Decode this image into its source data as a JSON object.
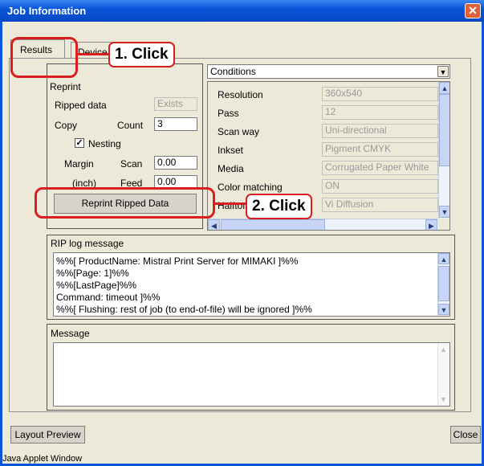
{
  "window": {
    "title": "Job Information",
    "close_symbol": "✕",
    "status": "Java Applet Window"
  },
  "tabs": [
    {
      "label": "Results"
    },
    {
      "label": "Device"
    }
  ],
  "callouts": {
    "first": "1. Click",
    "second": "2. Click"
  },
  "reprint": {
    "title": "Reprint",
    "ripped_data_label": "Ripped data",
    "ripped_data_value": "Exists",
    "copy_label": "Copy",
    "count_label": "Count",
    "count_value": "3",
    "nesting_label": "Nesting",
    "nesting_checked": true,
    "margin_label": "Margin",
    "inch_label": "(inch)",
    "scan_label": "Scan",
    "scan_value": "0.00",
    "feed_label": "Feed",
    "feed_value": "0.00",
    "button_label": "Reprint Ripped Data"
  },
  "conditions": {
    "selected": "Conditions",
    "rows": [
      {
        "label": "Resolution",
        "value": "360x540"
      },
      {
        "label": "Pass",
        "value": "12"
      },
      {
        "label": "Scan way",
        "value": "Uni-directional"
      },
      {
        "label": "Inkset",
        "value": "Pigment CMYK"
      },
      {
        "label": "Media",
        "value": "Corrugated Paper White"
      },
      {
        "label": "Color matching",
        "value": "ON"
      },
      {
        "label": "Halftone",
        "value": "Vi Diffusion"
      }
    ]
  },
  "rip_log": {
    "title": "RIP log message",
    "lines": [
      "%%[ ProductName: Mistral Print Server for MIMAKI ]%%",
      "%%[Page: 1]%%",
      "%%[LastPage]%%",
      "Command: timeout ]%%",
      "%%[ Flushing: rest of job (to end-of-file) will be ignored ]%%"
    ]
  },
  "message": {
    "title": "Message",
    "text": ""
  },
  "footer": {
    "layout_preview": "Layout Preview",
    "close": "Close"
  },
  "colors": {
    "title_bar": "#0a55d9",
    "callout_red": "#d81e1e",
    "window_bg": "#ece9d8"
  },
  "icons": {
    "close": "close-icon",
    "dropdown": "triangle-down-icon",
    "scroll_up": "chevron-up-icon",
    "scroll_down": "chevron-down-icon",
    "scroll_left": "chevron-left-icon",
    "scroll_right": "chevron-right-icon",
    "check": "checkmark-icon"
  }
}
